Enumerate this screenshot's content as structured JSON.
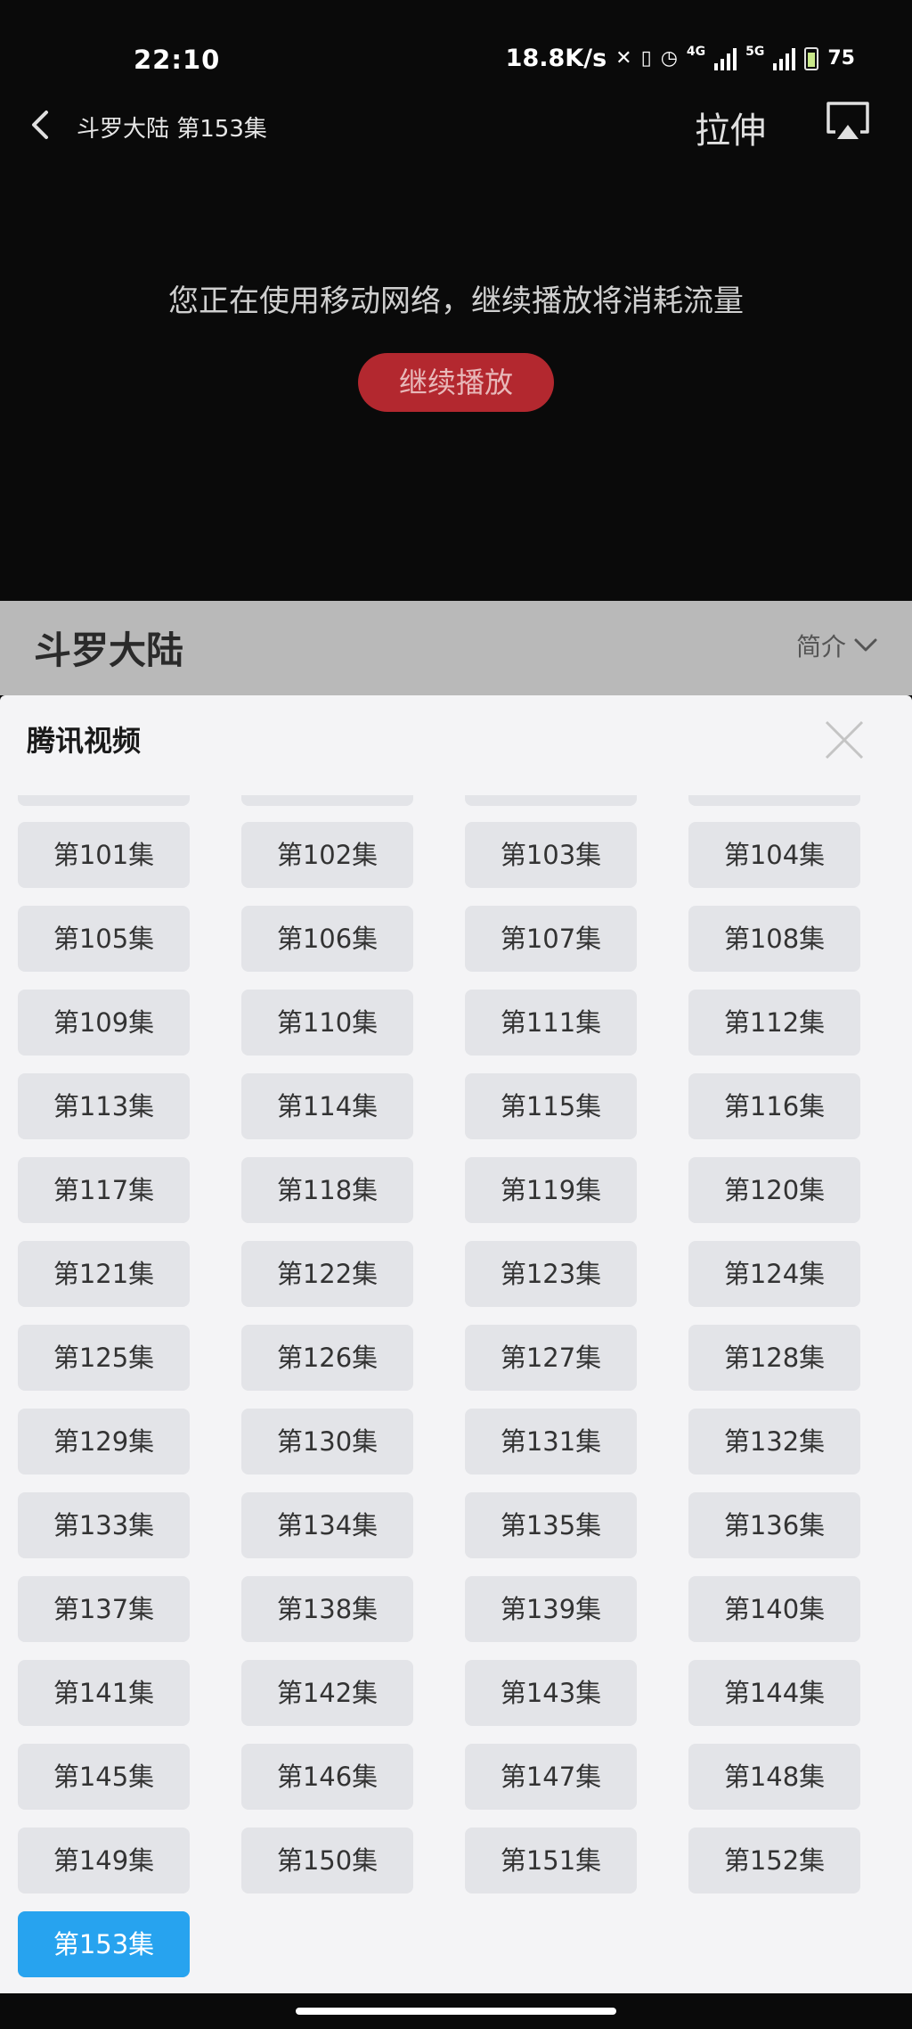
{
  "status": {
    "time": "22:10",
    "net_speed": "18.8K/s",
    "net_4g": "4G",
    "net_5g": "5G",
    "battery": "75"
  },
  "player": {
    "title": "斗罗大陆 第153集",
    "stretch_label": "拉伸",
    "warning_text": "您正在使用移动网络，继续播放将消耗流量",
    "continue_label": "继续播放"
  },
  "show": {
    "title": "斗罗大陆",
    "intro_label": "简介"
  },
  "episode_panel": {
    "source_label": "腾讯视频",
    "episodes": [
      "第101集",
      "第102集",
      "第103集",
      "第104集",
      "第105集",
      "第106集",
      "第107集",
      "第108集",
      "第109集",
      "第110集",
      "第111集",
      "第112集",
      "第113集",
      "第114集",
      "第115集",
      "第116集",
      "第117集",
      "第118集",
      "第119集",
      "第120集",
      "第121集",
      "第122集",
      "第123集",
      "第124集",
      "第125集",
      "第126集",
      "第127集",
      "第128集",
      "第129集",
      "第130集",
      "第131集",
      "第132集",
      "第133集",
      "第134集",
      "第135集",
      "第136集",
      "第137集",
      "第138集",
      "第139集",
      "第140集",
      "第141集",
      "第142集",
      "第143集",
      "第144集",
      "第145集",
      "第146集",
      "第147集",
      "第148集",
      "第149集",
      "第150集",
      "第151集",
      "第152集",
      "第153集"
    ],
    "selected_episode": "第153集"
  },
  "colors": {
    "accent_selected": "#27a3ef",
    "continue_button": "#b3282f"
  },
  "icons": [
    "back-arrow-icon",
    "cast-icon",
    "chevron-down-icon",
    "close-icon",
    "battery-icon",
    "signal-icon",
    "alarm-icon",
    "vibrate-icon",
    "bluetooth-icon"
  ]
}
